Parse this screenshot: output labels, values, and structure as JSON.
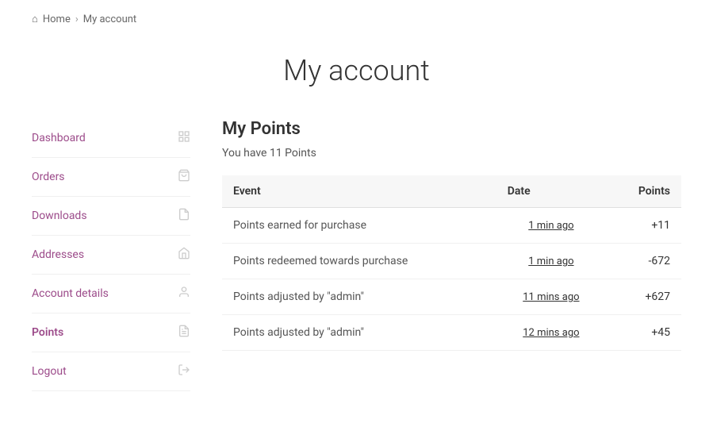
{
  "breadcrumb": {
    "home_label": "Home",
    "current_label": "My account",
    "sep": "›",
    "home_icon": "⌂"
  },
  "page_title": "My account",
  "sidebar": {
    "items": [
      {
        "label": "Dashboard",
        "icon": "⊞",
        "active": false
      },
      {
        "label": "Orders",
        "icon": "🛒",
        "active": false
      },
      {
        "label": "Downloads",
        "icon": "📄",
        "active": false
      },
      {
        "label": "Addresses",
        "icon": "🏠",
        "active": false
      },
      {
        "label": "Account details",
        "icon": "👤",
        "active": false
      },
      {
        "label": "Points",
        "icon": "📋",
        "active": true
      },
      {
        "label": "Logout",
        "icon": "→",
        "active": false
      }
    ]
  },
  "content": {
    "section_title": "My Points",
    "points_summary": "You have 11 Points",
    "table": {
      "headers": [
        "Event",
        "Date",
        "Points"
      ],
      "rows": [
        {
          "event": "Points earned for purchase",
          "date": "1 min ago",
          "points": "+11"
        },
        {
          "event": "Points redeemed towards purchase",
          "date": "1 min ago",
          "points": "-672"
        },
        {
          "event": "Points adjusted by \"admin\"",
          "date": "11 mins ago",
          "points": "+627"
        },
        {
          "event": "Points adjusted by \"admin\"",
          "date": "12 mins ago",
          "points": "+45"
        }
      ]
    }
  }
}
